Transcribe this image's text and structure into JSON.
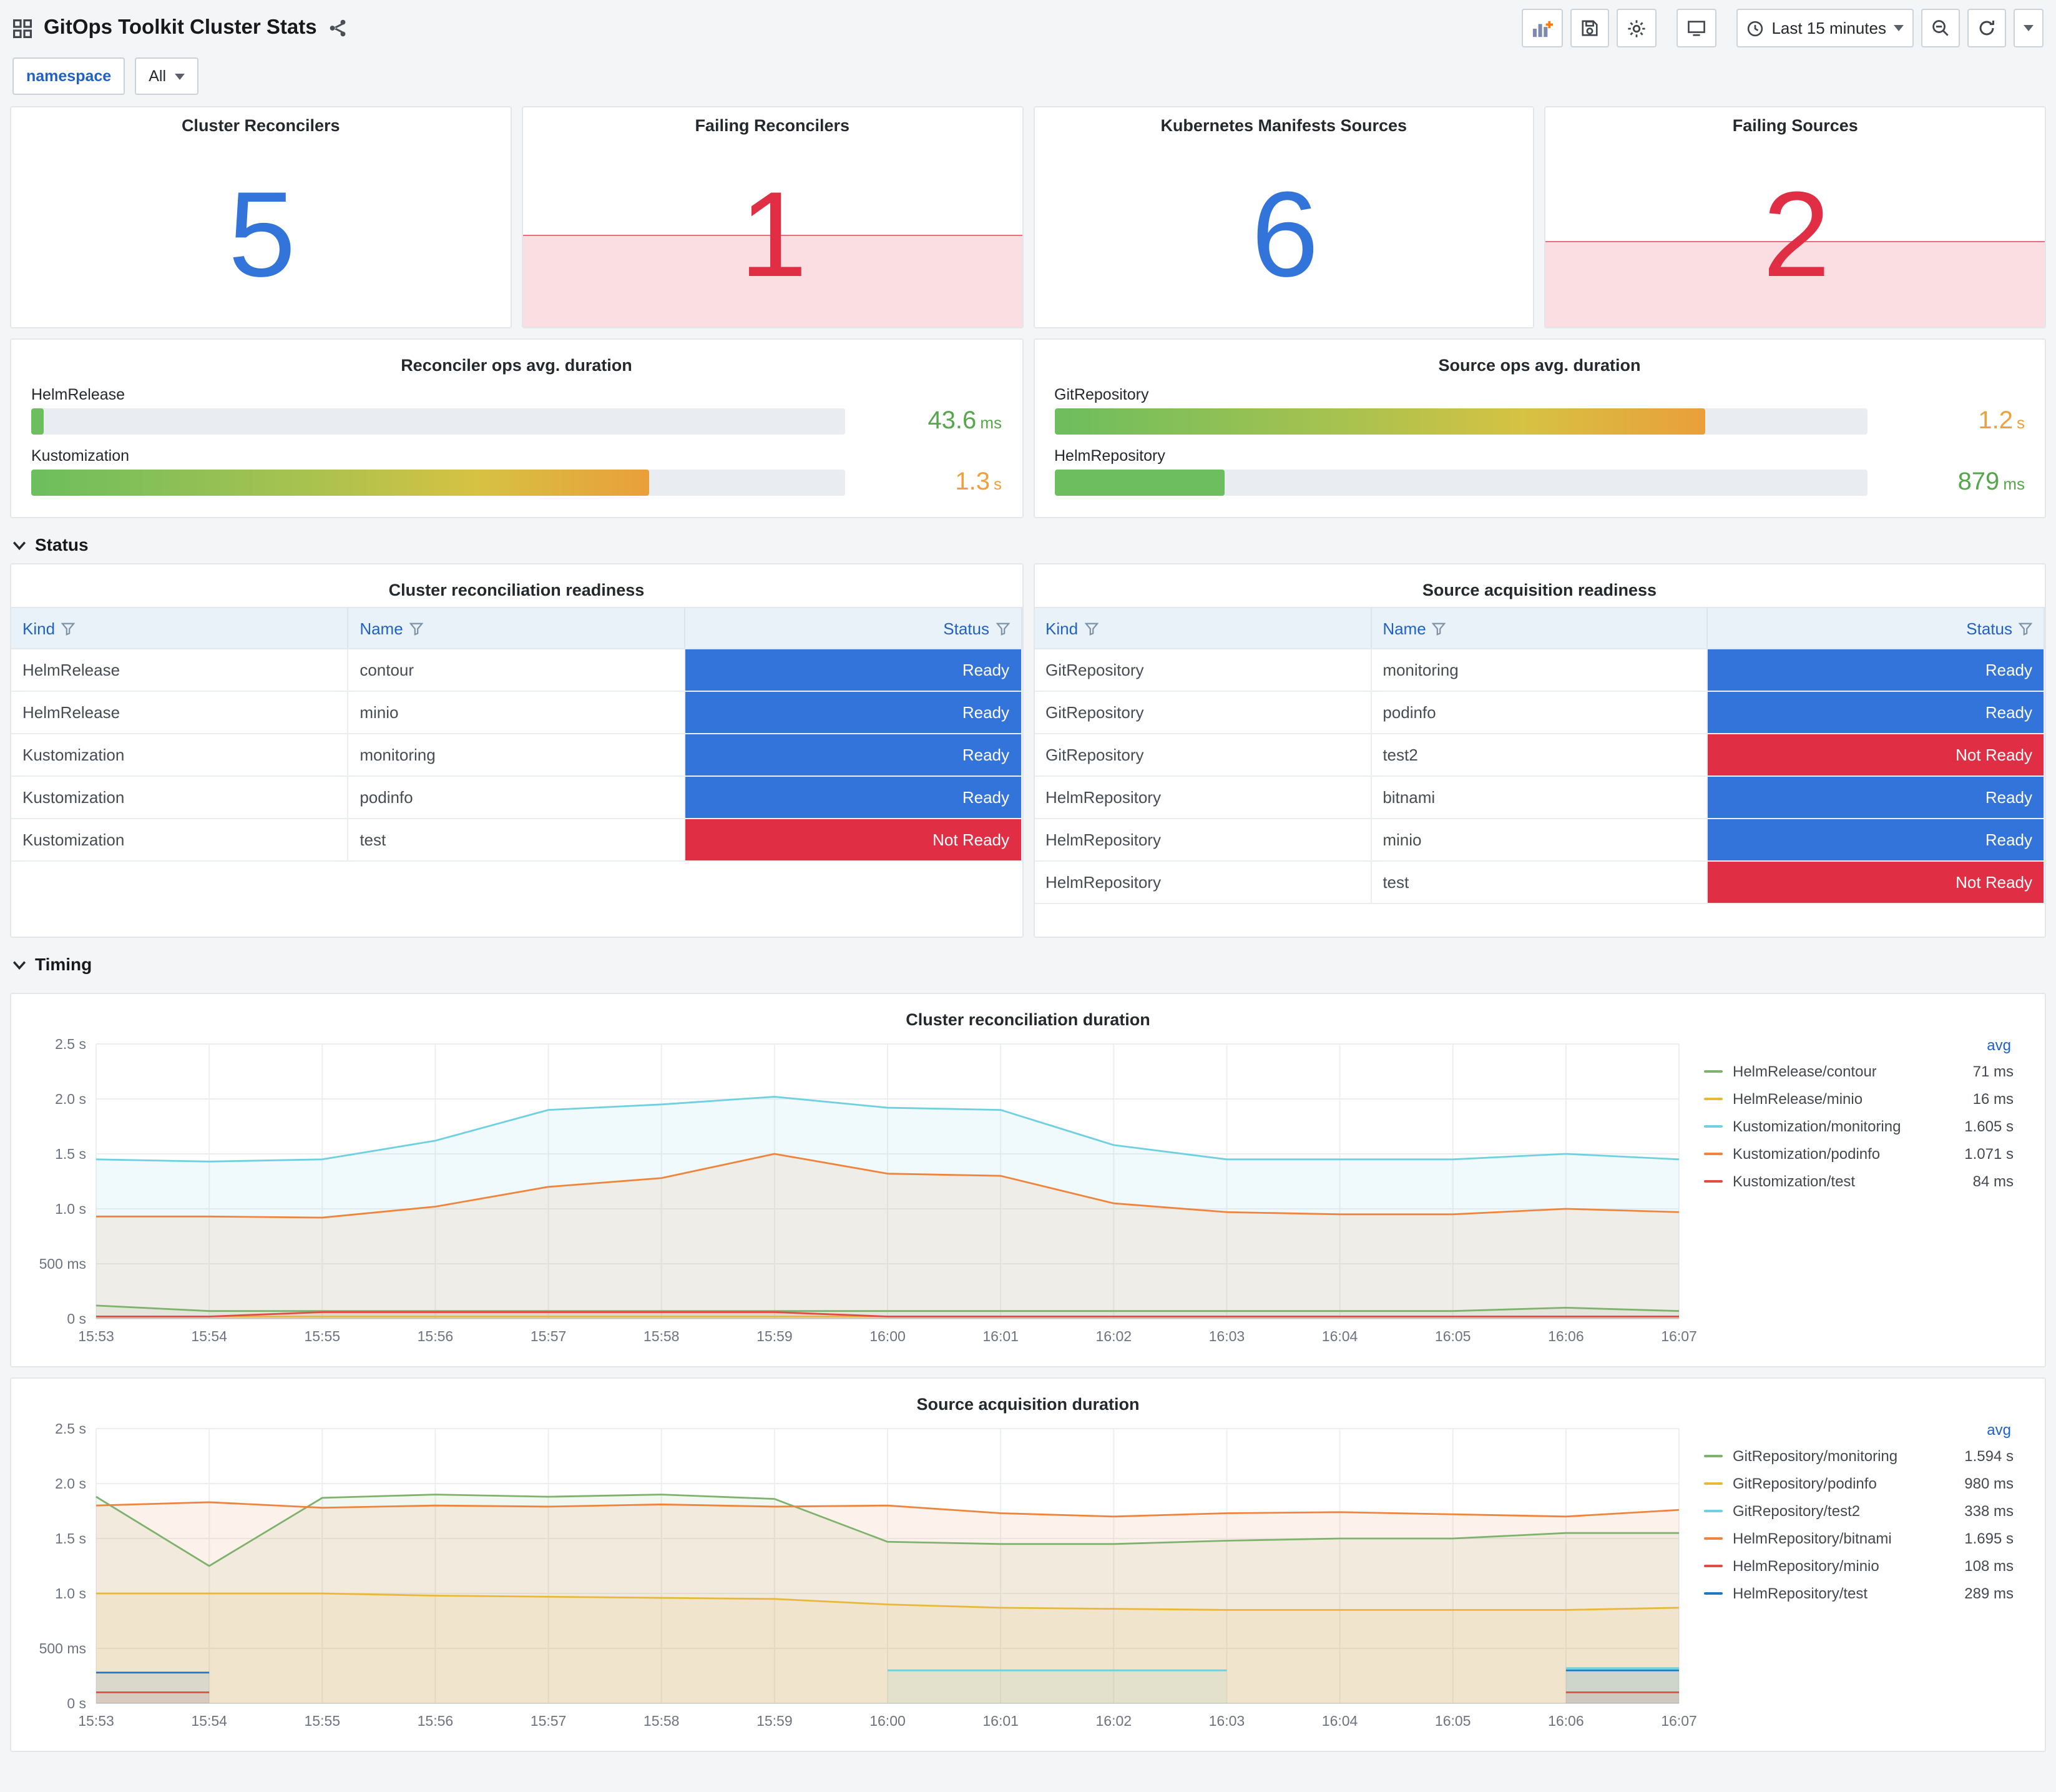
{
  "header": {
    "title": "GitOps Toolkit Cluster Stats",
    "time_range": "Last 15 minutes"
  },
  "variables": {
    "namespace_label": "namespace",
    "namespace_value": "All"
  },
  "sections": {
    "status": "Status",
    "timing": "Timing"
  },
  "stats": [
    {
      "title": "Cluster Reconcilers",
      "value": "5",
      "color": "#3274D9",
      "alert": false,
      "alert_height_pct": 0
    },
    {
      "title": "Failing Reconcilers",
      "value": "1",
      "color": "#E02F44",
      "alert": true,
      "alert_height_pct": 42
    },
    {
      "title": "Kubernetes Manifests Sources",
      "value": "6",
      "color": "#3274D9",
      "alert": false,
      "alert_height_pct": 0
    },
    {
      "title": "Failing Sources",
      "value": "2",
      "color": "#E02F44",
      "alert": true,
      "alert_height_pct": 39
    }
  ],
  "gauge_panels": [
    {
      "title": "Reconciler ops avg. duration",
      "bars": [
        {
          "label": "HelmRelease",
          "value": "43.6",
          "unit": "ms",
          "percent": 1.5,
          "value_color": "#56A64B",
          "gradient": false
        },
        {
          "label": "Kustomization",
          "value": "1.3",
          "unit": "s",
          "percent": 76,
          "value_color": "#EFA03C",
          "gradient": true
        }
      ]
    },
    {
      "title": "Source ops avg. duration",
      "bars": [
        {
          "label": "GitRepository",
          "value": "1.2",
          "unit": "s",
          "percent": 80,
          "value_color": "#EFA03C",
          "gradient": true
        },
        {
          "label": "HelmRepository",
          "value": "879",
          "unit": "ms",
          "percent": 21,
          "value_color": "#56A64B",
          "gradient": false
        }
      ]
    }
  ],
  "tables": [
    {
      "title": "Cluster reconciliation readiness",
      "columns": [
        "Kind",
        "Name",
        "Status"
      ],
      "rows": [
        {
          "kind": "HelmRelease",
          "name": "contour",
          "status": "Ready",
          "status_color": "#3274D9"
        },
        {
          "kind": "HelmRelease",
          "name": "minio",
          "status": "Ready",
          "status_color": "#3274D9"
        },
        {
          "kind": "Kustomization",
          "name": "monitoring",
          "status": "Ready",
          "status_color": "#3274D9"
        },
        {
          "kind": "Kustomization",
          "name": "podinfo",
          "status": "Ready",
          "status_color": "#3274D9"
        },
        {
          "kind": "Kustomization",
          "name": "test",
          "status": "Not Ready",
          "status_color": "#E02F44"
        }
      ]
    },
    {
      "title": "Source acquisition readiness",
      "columns": [
        "Kind",
        "Name",
        "Status"
      ],
      "rows": [
        {
          "kind": "GitRepository",
          "name": "monitoring",
          "status": "Ready",
          "status_color": "#3274D9"
        },
        {
          "kind": "GitRepository",
          "name": "podinfo",
          "status": "Ready",
          "status_color": "#3274D9"
        },
        {
          "kind": "GitRepository",
          "name": "test2",
          "status": "Not Ready",
          "status_color": "#E02F44"
        },
        {
          "kind": "HelmRepository",
          "name": "bitnami",
          "status": "Ready",
          "status_color": "#3274D9"
        },
        {
          "kind": "HelmRepository",
          "name": "minio",
          "status": "Ready",
          "status_color": "#3274D9"
        },
        {
          "kind": "HelmRepository",
          "name": "test",
          "status": "Not Ready",
          "status_color": "#E02F44"
        }
      ]
    }
  ],
  "chart_data": [
    {
      "type": "area",
      "title": "Cluster reconciliation duration",
      "legend_header": "avg",
      "x": [
        "15:53",
        "15:54",
        "15:55",
        "15:56",
        "15:57",
        "15:58",
        "15:59",
        "16:00",
        "16:01",
        "16:02",
        "16:03",
        "16:04",
        "16:05",
        "16:06",
        "16:07"
      ],
      "ylim": [
        0,
        2.5
      ],
      "yticks": [
        [
          0,
          "0 s"
        ],
        [
          0.5,
          "500 ms"
        ],
        [
          1,
          "1.0 s"
        ],
        [
          1.5,
          "1.5 s"
        ],
        [
          2,
          "2.0 s"
        ],
        [
          2.5,
          "2.5 s"
        ]
      ],
      "grid": true,
      "legend_position": "right",
      "series": [
        {
          "name": "HelmRelease/contour",
          "avg": "71 ms",
          "color": "#7EB26D",
          "values": [
            0.12,
            0.07,
            0.07,
            0.07,
            0.07,
            0.07,
            0.07,
            0.07,
            0.07,
            0.07,
            0.07,
            0.07,
            0.07,
            0.1,
            0.07
          ]
        },
        {
          "name": "HelmRelease/minio",
          "avg": "16 ms",
          "color": "#EAB839",
          "values": [
            0.02,
            0.02,
            0.02,
            0.02,
            0.02,
            0.02,
            0.02,
            0.02,
            0.02,
            0.02,
            0.02,
            0.02,
            0.02,
            0.02,
            0.02
          ]
        },
        {
          "name": "Kustomization/monitoring",
          "avg": "1.605 s",
          "color": "#6ED0E0",
          "values": [
            1.45,
            1.43,
            1.45,
            1.62,
            1.9,
            1.95,
            2.02,
            1.92,
            1.9,
            1.58,
            1.45,
            1.45,
            1.45,
            1.5,
            1.45
          ]
        },
        {
          "name": "Kustomization/podinfo",
          "avg": "1.071 s",
          "color": "#EF843C",
          "values": [
            0.93,
            0.93,
            0.92,
            1.02,
            1.2,
            1.28,
            1.5,
            1.32,
            1.3,
            1.05,
            0.97,
            0.95,
            0.95,
            1.0,
            0.97
          ]
        },
        {
          "name": "Kustomization/test",
          "avg": "84 ms",
          "color": "#E24D42",
          "values": [
            0.02,
            0.02,
            0.06,
            0.06,
            0.06,
            0.06,
            0.06,
            0.02,
            0.02,
            0.02,
            0.02,
            0.02,
            0.02,
            0.02,
            0.02
          ]
        }
      ]
    },
    {
      "type": "area",
      "title": "Source acquisition duration",
      "legend_header": "avg",
      "x": [
        "15:53",
        "15:54",
        "15:55",
        "15:56",
        "15:57",
        "15:58",
        "15:59",
        "16:00",
        "16:01",
        "16:02",
        "16:03",
        "16:04",
        "16:05",
        "16:06",
        "16:07"
      ],
      "ylim": [
        0,
        2.5
      ],
      "yticks": [
        [
          0,
          "0 s"
        ],
        [
          0.5,
          "500 ms"
        ],
        [
          1,
          "1.0 s"
        ],
        [
          1.5,
          "1.5 s"
        ],
        [
          2,
          "2.0 s"
        ],
        [
          2.5,
          "2.5 s"
        ]
      ],
      "grid": true,
      "legend_position": "right",
      "series": [
        {
          "name": "GitRepository/monitoring",
          "avg": "1.594 s",
          "color": "#7EB26D",
          "values": [
            1.88,
            1.25,
            1.87,
            1.9,
            1.88,
            1.9,
            1.86,
            1.47,
            1.45,
            1.45,
            1.48,
            1.5,
            1.5,
            1.55,
            1.55
          ]
        },
        {
          "name": "GitRepository/podinfo",
          "avg": "980 ms",
          "color": "#EAB839",
          "values": [
            1.0,
            1.0,
            1.0,
            0.98,
            0.97,
            0.96,
            0.95,
            0.9,
            0.87,
            0.86,
            0.85,
            0.85,
            0.85,
            0.85,
            0.87
          ]
        },
        {
          "name": "GitRepository/test2",
          "avg": "338 ms",
          "color": "#6ED0E0",
          "values": [
            null,
            null,
            null,
            null,
            null,
            null,
            null,
            0.3,
            0.3,
            0.3,
            0.3,
            null,
            null,
            0.32,
            0.32
          ]
        },
        {
          "name": "HelmRepository/bitnami",
          "avg": "1.695 s",
          "color": "#EF843C",
          "values": [
            1.8,
            1.83,
            1.78,
            1.8,
            1.79,
            1.81,
            1.79,
            1.8,
            1.73,
            1.7,
            1.73,
            1.74,
            1.72,
            1.7,
            1.76
          ]
        },
        {
          "name": "HelmRepository/minio",
          "avg": "108 ms",
          "color": "#E24D42",
          "values": [
            0.1,
            0.1,
            null,
            null,
            null,
            null,
            null,
            null,
            null,
            null,
            null,
            null,
            null,
            0.1,
            0.1
          ]
        },
        {
          "name": "HelmRepository/test",
          "avg": "289 ms",
          "color": "#1F78C1",
          "values": [
            0.28,
            0.28,
            null,
            null,
            null,
            null,
            null,
            null,
            null,
            null,
            null,
            null,
            null,
            0.3,
            0.3
          ]
        }
      ]
    }
  ]
}
